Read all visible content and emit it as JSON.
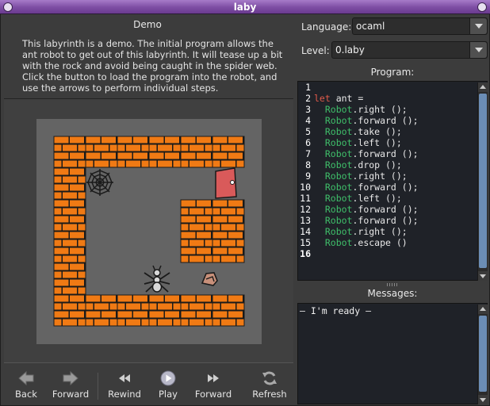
{
  "window": {
    "title": "laby"
  },
  "left": {
    "heading": "Demo",
    "description": "This labyrinth is a demo. The initial program allows the ant robot to get out of this labyrinth. It will tease up a bit with the rock and avoid being caught in the spider web. Click the button to load the program into the robot, and use the arrows to perform individual steps."
  },
  "toolbar": {
    "back": "Back",
    "forward": "Forward",
    "rewind": "Rewind",
    "play": "Play",
    "step_forward": "Forward",
    "refresh": "Refresh"
  },
  "right": {
    "language_label": "Language:",
    "language_value": "ocaml",
    "level_label": "Level:",
    "level_value": "0.laby",
    "program_title": "Program:",
    "messages_title": "Messages:"
  },
  "code_lines": [
    {
      "num": "1",
      "kw": "",
      "mod": "",
      "rest": ""
    },
    {
      "num": "2",
      "kw": "let",
      "mod": "",
      "rest": " ant ="
    },
    {
      "num": "3",
      "kw": "",
      "mod": "  Robot",
      "rest": ".right ();"
    },
    {
      "num": "4",
      "kw": "",
      "mod": "  Robot",
      "rest": ".forward ();"
    },
    {
      "num": "5",
      "kw": "",
      "mod": "  Robot",
      "rest": ".take ();"
    },
    {
      "num": "6",
      "kw": "",
      "mod": "  Robot",
      "rest": ".left ();"
    },
    {
      "num": "7",
      "kw": "",
      "mod": "  Robot",
      "rest": ".forward ();"
    },
    {
      "num": "8",
      "kw": "",
      "mod": "  Robot",
      "rest": ".drop ();"
    },
    {
      "num": "9",
      "kw": "",
      "mod": "  Robot",
      "rest": ".right ();"
    },
    {
      "num": "10",
      "kw": "",
      "mod": "  Robot",
      "rest": ".forward ();"
    },
    {
      "num": "11",
      "kw": "",
      "mod": "  Robot",
      "rest": ".left ();"
    },
    {
      "num": "12",
      "kw": "",
      "mod": "  Robot",
      "rest": ".forward ();"
    },
    {
      "num": "13",
      "kw": "",
      "mod": "  Robot",
      "rest": ".forward ();"
    },
    {
      "num": "14",
      "kw": "",
      "mod": "  Robot",
      "rest": ".right ();"
    },
    {
      "num": "15",
      "kw": "",
      "mod": "  Robot",
      "rest": ".escape ()"
    },
    {
      "num": "16",
      "kw": "",
      "mod": "",
      "rest": ""
    }
  ],
  "messages": {
    "text": "— I'm ready —"
  },
  "labyrinth": {
    "rows": [
      "wwwwww",
      "wo...x",
      "w...ww",
      "w...ww",
      "w..a.r",
      "wwwwww"
    ],
    "legend": {
      "w": "wall",
      "o": "spider-web",
      "x": "exit-door",
      "a": "ant",
      "r": "rock",
      ".": "floor"
    }
  },
  "colors": {
    "titlebar": "#7d4da3",
    "brick": "#f07a14",
    "keyword": "#e05a4a",
    "module": "#3fbf6a",
    "door": "#d95a5a",
    "scroll_thumb": "#6b8db5"
  }
}
